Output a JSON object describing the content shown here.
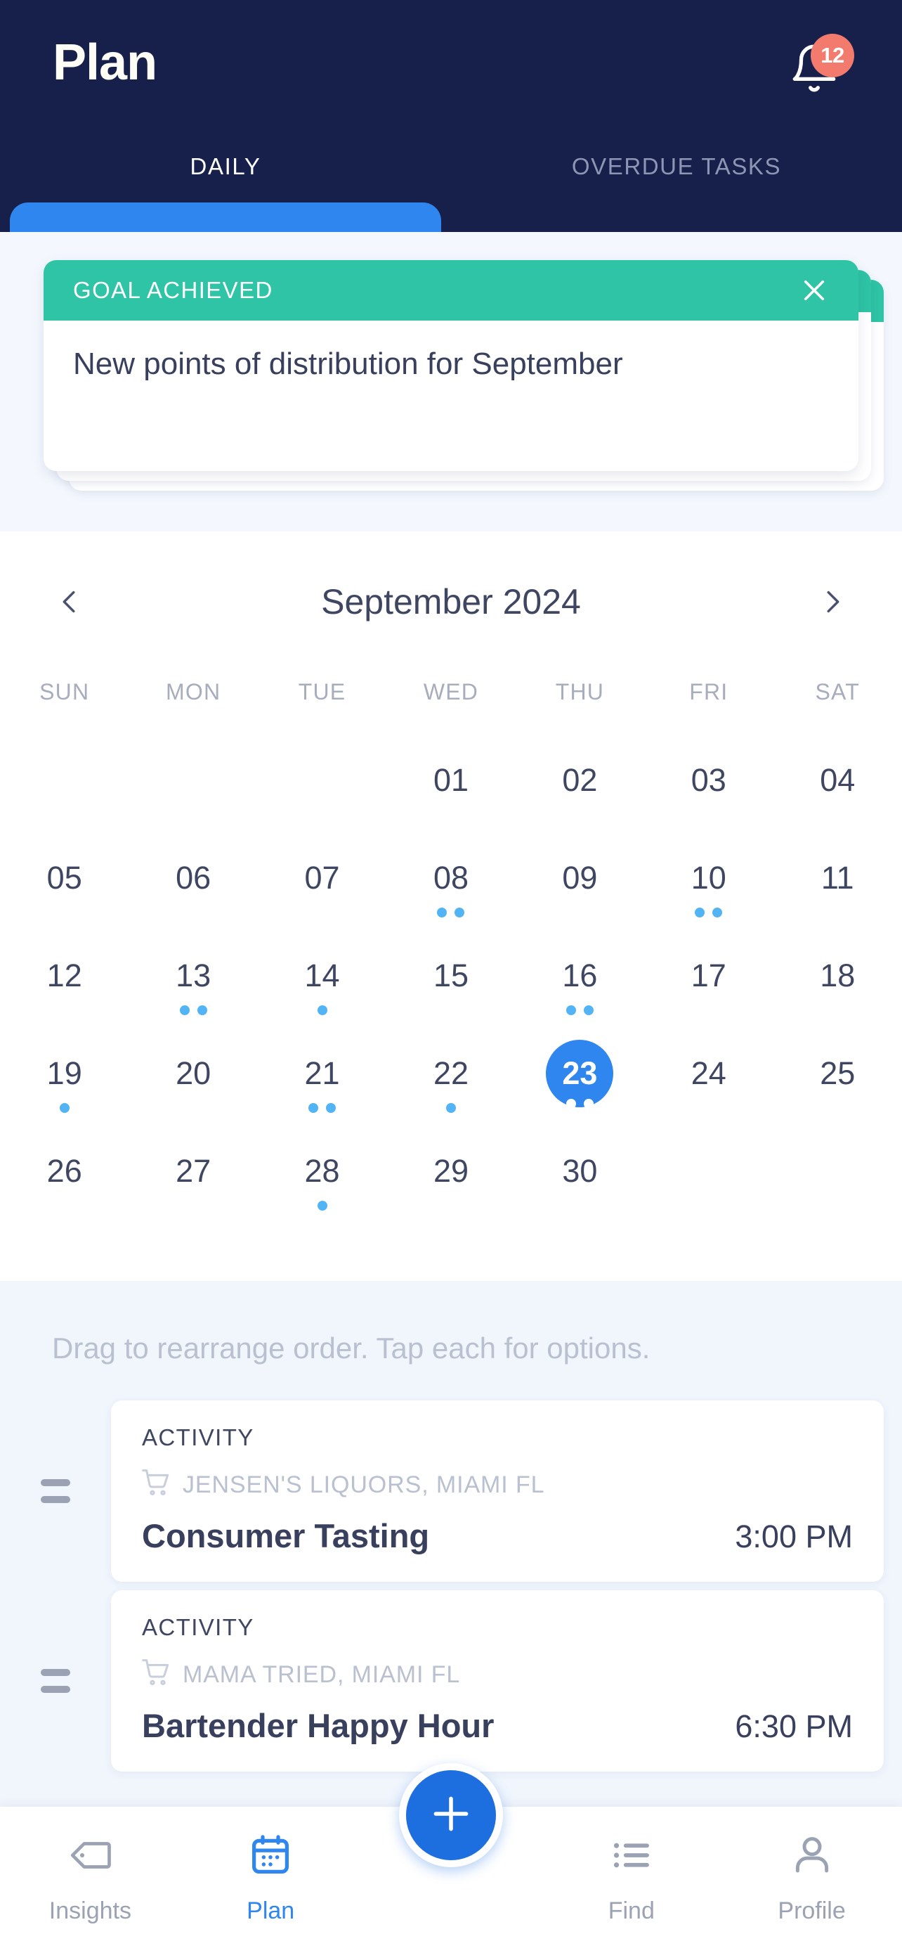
{
  "header": {
    "title": "Plan",
    "notification_count": "12",
    "bell_icon": "bell-icon",
    "tabs": [
      {
        "label": "DAILY",
        "active": true
      },
      {
        "label": "OVERDUE TASKS",
        "active": false
      }
    ]
  },
  "goal_banner": {
    "kicker": "GOAL ACHIEVED",
    "close_icon": "close-icon",
    "text": "New points of distribution for September",
    "header_color": "#2ec4a5",
    "stack_count": 3
  },
  "calendar": {
    "month_label": "September 2024",
    "prev_icon": "chevron-left-icon",
    "next_icon": "chevron-right-icon",
    "weekdays": [
      "SUN",
      "MON",
      "TUE",
      "WED",
      "THU",
      "FRI",
      "SAT"
    ],
    "selected_day": "23",
    "dot_color": "#52b4f5",
    "selected_color": "#2f86ef",
    "weeks": [
      [
        {
          "label": "",
          "empty": true,
          "dots": 0
        },
        {
          "label": "",
          "empty": true,
          "dots": 0
        },
        {
          "label": "",
          "empty": true,
          "dots": 0
        },
        {
          "label": "01",
          "empty": false,
          "dots": 0
        },
        {
          "label": "02",
          "empty": false,
          "dots": 0
        },
        {
          "label": "03",
          "empty": false,
          "dots": 0
        },
        {
          "label": "04",
          "empty": false,
          "dots": 0
        }
      ],
      [
        {
          "label": "05",
          "empty": false,
          "dots": 0
        },
        {
          "label": "06",
          "empty": false,
          "dots": 0
        },
        {
          "label": "07",
          "empty": false,
          "dots": 0
        },
        {
          "label": "08",
          "empty": false,
          "dots": 2
        },
        {
          "label": "09",
          "empty": false,
          "dots": 0
        },
        {
          "label": "10",
          "empty": false,
          "dots": 2
        },
        {
          "label": "11",
          "empty": false,
          "dots": 0
        }
      ],
      [
        {
          "label": "12",
          "empty": false,
          "dots": 0
        },
        {
          "label": "13",
          "empty": false,
          "dots": 2
        },
        {
          "label": "14",
          "empty": false,
          "dots": 1
        },
        {
          "label": "15",
          "empty": false,
          "dots": 0
        },
        {
          "label": "16",
          "empty": false,
          "dots": 2
        },
        {
          "label": "17",
          "empty": false,
          "dots": 0
        },
        {
          "label": "18",
          "empty": false,
          "dots": 0
        }
      ],
      [
        {
          "label": "19",
          "empty": false,
          "dots": 1
        },
        {
          "label": "20",
          "empty": false,
          "dots": 0
        },
        {
          "label": "21",
          "empty": false,
          "dots": 2
        },
        {
          "label": "22",
          "empty": false,
          "dots": 1
        },
        {
          "label": "23",
          "empty": false,
          "dots": 2,
          "selected": true
        },
        {
          "label": "24",
          "empty": false,
          "dots": 0
        },
        {
          "label": "25",
          "empty": false,
          "dots": 0
        }
      ],
      [
        {
          "label": "26",
          "empty": false,
          "dots": 0
        },
        {
          "label": "27",
          "empty": false,
          "dots": 0
        },
        {
          "label": "28",
          "empty": false,
          "dots": 1
        },
        {
          "label": "29",
          "empty": false,
          "dots": 0
        },
        {
          "label": "30",
          "empty": false,
          "dots": 0
        },
        {
          "label": "",
          "empty": true,
          "dots": 0
        },
        {
          "label": "",
          "empty": true,
          "dots": 0
        }
      ]
    ]
  },
  "activities": {
    "hint": "Drag to rearrange order. Tap each for options.",
    "drag_handle_icon": "drag-handle-icon",
    "place_icon": "shopping-cart-icon",
    "items": [
      {
        "kind": "ACTIVITY",
        "place": "JENSEN'S LIQUORS, MIAMI FL",
        "title": "Consumer Tasting",
        "time": "3:00 PM"
      },
      {
        "kind": "ACTIVITY",
        "place": "MAMA TRIED, MIAMI FL",
        "title": "Bartender Happy Hour",
        "time": "6:30 PM"
      }
    ]
  },
  "bottom_nav": {
    "fab_icon": "plus-icon",
    "items": [
      {
        "label": "Insights",
        "icon": "tag-icon",
        "active": false
      },
      {
        "label": "Plan",
        "icon": "calendar-icon",
        "active": true
      },
      {
        "label": "Find",
        "icon": "list-icon",
        "active": false
      },
      {
        "label": "Profile",
        "icon": "person-icon",
        "active": false
      }
    ]
  }
}
